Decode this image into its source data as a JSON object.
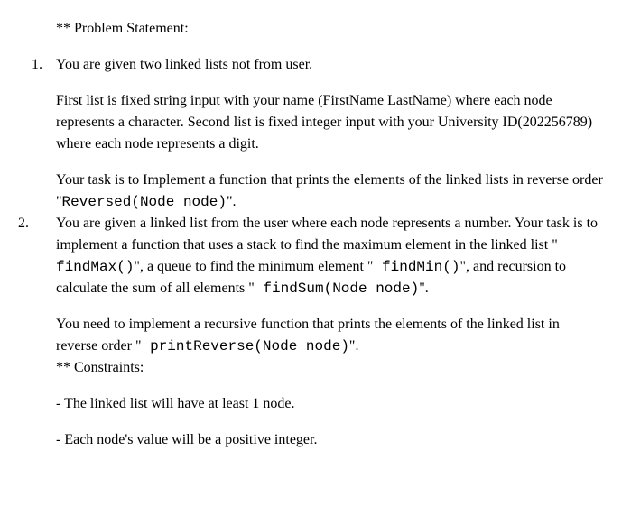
{
  "header": {
    "problem_statement": "** Problem Statement:"
  },
  "item1": {
    "number": "1.",
    "intro": "You are given two linked lists not from user.",
    "para1_part1": "First list is fixed string input with your name (FirstName LastName) where each node represents a character. Second list is fixed integer input with your University ID(202256789) where each node represents a digit.",
    "para2_prefix": "Your task is to Implement a function that prints the elements of the linked lists in reverse order \"",
    "para2_code": "Reversed(Node node)",
    "para2_suffix": "\"."
  },
  "item2": {
    "number": "2.",
    "para1_prefix": "You are given a linked list from the user where each node represents a number. Your task is to implement a function that uses a stack to find the maximum element in the linked list \"",
    "para1_code1": " findMax()",
    "para1_mid1": "\", a queue to find the minimum element \"",
    "para1_code2": " findMin()",
    "para1_mid2": "\", and recursion to calculate the sum of all elements \"",
    "para1_code3": " findSum(Node node)",
    "para1_suffix": "\".",
    "para2_prefix": "You need to implement a recursive function that prints the elements of the linked list in reverse order \"",
    "para2_code": " printReverse(Node node)",
    "para2_suffix": "\"."
  },
  "constraints": {
    "header": "** Constraints:",
    "c1": "- The linked list will have at least 1 node.",
    "c2": "- Each node's value will be a positive integer."
  }
}
